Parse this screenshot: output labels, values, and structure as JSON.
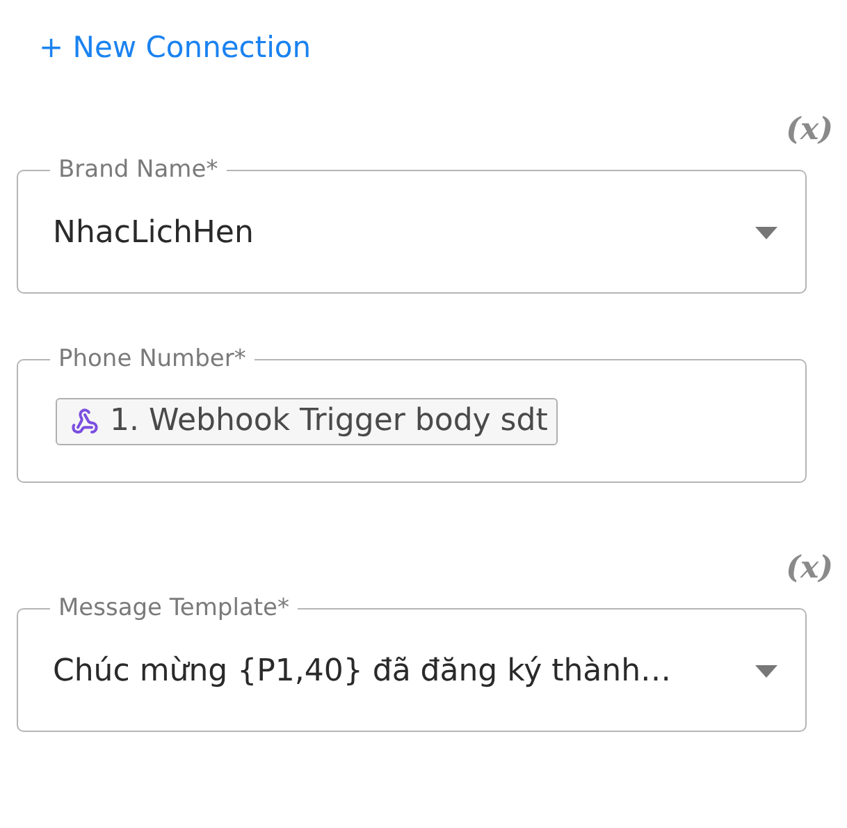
{
  "new_connection_link": "+ New Connection",
  "fields": [
    {
      "kind": "select",
      "variable_toggle": "(x)",
      "label": "Brand Name*",
      "value": "NhacLichHen"
    },
    {
      "kind": "chip",
      "label": "Phone Number*",
      "value": "1. Webhook Trigger body sdt"
    },
    {
      "kind": "select",
      "variable_toggle": "(x)",
      "label": "Message Template*",
      "value": "Chúc mừng {P1,40} đã đăng ký thành…"
    }
  ]
}
